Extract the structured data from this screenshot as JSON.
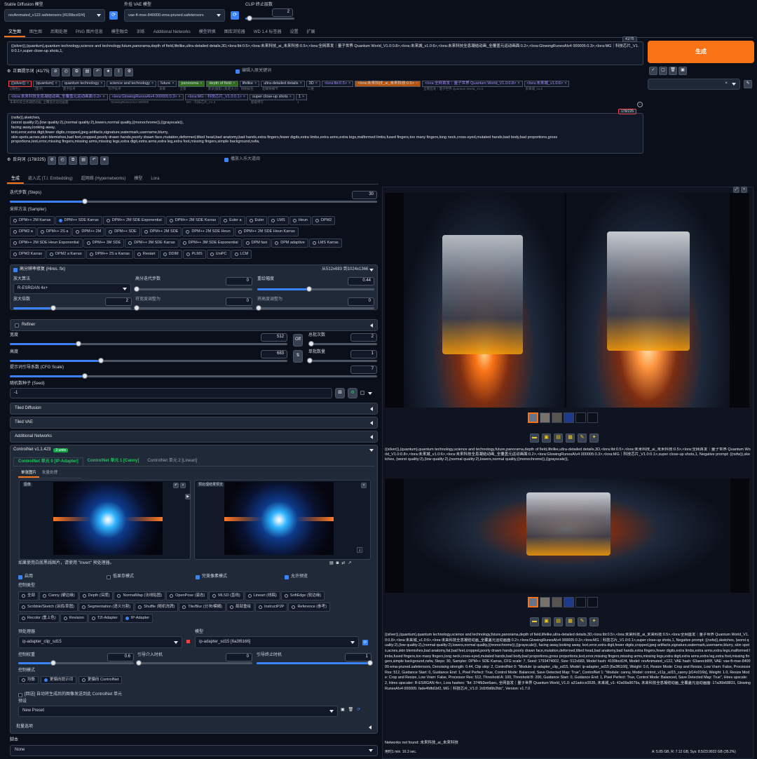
{
  "top": {
    "sd_model_label": "Stable Diffusion 模型",
    "sd_model_value": "revAnimated_v122.safetensors [4199bcd1f4]",
    "vae_label": "外挂 VAE 模型",
    "vae_value": "vae-ft-mse-840000-ema-pruned.safetensors",
    "clip_label": "CLIP 终止层数",
    "clip_value": "2"
  },
  "tabs": [
    "文生图",
    "图生图",
    "后期处理",
    "PNG 图片信息",
    "模型融合",
    "训练",
    "Additional Networks",
    "模型转换",
    "图库浏览器",
    "WD 1.4 标签器",
    "设置",
    "扩展"
  ],
  "prompt": {
    "text": "((silver)),(quantum),quantum technology,science and technology,future,panorama,depth of field,lifelike,ultra-detailed details,3D,<lora:lbt:0.5>,<lora:未来科技_ai_未来科技:0.5>,<lora:全网首发｜量子世界 Quantum World_V1.0:0.8>,<lora:未来城_v1.0:6>,<lora:未来科技全息凝结动画_全覆盖元运动画面:0.2>,<lora:GlowingRunesAIv4 000005:0.3>,<lora:MG｜科技芯片_V1.0:0.1>,super close-up shots,1,",
    "count": "41/75"
  },
  "generate_label": "生成",
  "pos_toolbar": {
    "label": "正面提示词",
    "count": "(41/75)",
    "translate_label": "编辑入原关键词"
  },
  "tokens_row1": [
    {
      "t": "((silver))",
      "s": "((银色))",
      "style": "red"
    },
    {
      "t": "(quantum)",
      "s": "(量子)"
    },
    {
      "t": "quantum technology",
      "s": "量子技术"
    },
    {
      "t": "science and technology",
      "s": "科学技术"
    },
    {
      "t": "future",
      "s": "未来"
    },
    {
      "t": "panorama",
      "s": "全景",
      "style": "green"
    },
    {
      "t": "depth of field",
      "s": "景深(摄影) (焦距大小)",
      "style": "green"
    },
    {
      "t": "lifelike",
      "s": "栩栩如生"
    },
    {
      "t": "ultra-detailed details",
      "s": "超细致细节"
    },
    {
      "t": "3D",
      "s": "三维"
    },
    {
      "t": "<lora:lbt:0.5>",
      "s": "",
      "style": "purple"
    },
    {
      "t": "<lora:未来科技_ai_未来科技:0.5>",
      "s": "",
      "style": "orange"
    },
    {
      "t": "<lora:全网首发｜量子世界 Quantum World_V1.0:0.8>",
      "s": "全网首发｜量子世界 Quantum World_V1.0",
      "style": "purple"
    },
    {
      "t": "<lora:未来城_v1.0:6>",
      "s": "未来城_v1.0",
      "style": "purple"
    }
  ],
  "tokens_row2": [
    {
      "t": "<lora:未来科技全息凝结动画_全覆盖元运动画面:0.2>",
      "s": "未来科技全息凝结动画_全覆盖元运动画面",
      "style": "purple"
    },
    {
      "t": "<lora:GlowingRunesAIv4 000005:0.3>",
      "s": "GlowingRunesAIv4 000005",
      "style": "purple"
    },
    {
      "t": "<lora:MG｜科技芯片_V1.0:0.1>",
      "s": "MG｜科技芯片_V1.0",
      "style": "purple"
    },
    {
      "t": "super close-up shots",
      "s": "超级特写"
    },
    {
      "t": "1",
      "s": "1"
    }
  ],
  "negative": {
    "lines": [
      "(nsfw)),sketches,",
      "(worst quality:2),(low quality:2),(normal quality:2),lowers,normal quality,((monochrome)),((grayscale)),",
      "facing away,looking away,",
      "text,error,extra digit,fewer digits,cropped,jpeg artifacts,signature,watermark,username,blurry,",
      "skin spots,acnes,skin blemishes,bad feet,cropped,poorly drawn hands,poorly drawn face,mutation,deformed,tilted head,bad anatomy,bad hands,extra fingers,fewer digits,extra limbs,extra arms,extra legs,malformed limbs,fused fingers,too many fingers,long neck,cross-eyed,mutated hands,bad body,bad proportions,gross",
      "proportions,text,error,missing fingers,missing arms,missing legs,extra digit,extra arms,extra leg,extra foot,missing fingers,simple background,nsfw,"
    ],
    "count": "178/225"
  },
  "neg_toolbar": {
    "label": "反向词",
    "count": "(178/225)",
    "translate_label": "播放入乐大道阅"
  },
  "subtabs": [
    "生成",
    "嵌入式 (T.I. Embedding)",
    "超网络 (Hypernetworks)",
    "模型",
    "Lora"
  ],
  "steps": {
    "label": "迭代步数 (Steps)",
    "value": "30",
    "frac": 0.2
  },
  "sampler": {
    "label": "采样方法 (Sampler)",
    "rows": [
      [
        "DPM++ 2M Karras",
        "DPM++ SDE Karras",
        "DPM++ 2M SDE Exponential",
        "DPM++ 2M SDE Karras",
        "Euler a",
        "Euler",
        "LMS",
        "Heun",
        "DPM2"
      ],
      [
        "DPM2 a",
        "DPM++ 2S a",
        "DPM++ 2M",
        "DPM++ SDE",
        "DPM++ 2M SDE",
        "DPM++ 2M SDE Heun",
        "DPM++ 2M SDE Heun Karras"
      ],
      [
        "DPM++ 2M SDE Heun Exponential",
        "DPM++ 3M SDE",
        "DPM++ 3M SDE Karras",
        "DPM++ 3M SDE Exponential",
        "DPM fast",
        "DPM adaptive",
        "LMS Karras"
      ],
      [
        "DPM2 Karras",
        "DPM2 a Karras",
        "DPM++ 2S a Karras",
        "Restart",
        "DDIM",
        "PLMS",
        "UniPC",
        "LCM"
      ]
    ],
    "selected": "DPM++ SDE Karras"
  },
  "hires": {
    "label": "高分辨率修复 (Hires. fix)",
    "info": "从512x683 到1024x1366",
    "upscaler_label": "放大算法",
    "upscaler_value": "R-ESRGAN 4x+",
    "steps_label": "高分迭代步数",
    "steps_value": "0",
    "denoise_label": "重绘幅度",
    "denoise_value": "0.44",
    "scale_label": "放大倍数",
    "scale_value": "2",
    "w_label": "将宽度调整为",
    "w_value": "0",
    "h_label": "将高度调整为",
    "h_value": "0"
  },
  "refiner_label": "Refiner",
  "size": {
    "width_label": "宽度",
    "width_value": "512",
    "height_label": "高度",
    "height_value": "683",
    "batch_count_label": "总批次数",
    "batch_count_value": "2",
    "batch_size_label": "单批数量",
    "batch_size_value": "1",
    "cfg_label": "提示词引导系数 (CFG Scale)",
    "cfg_value": "7",
    "off": "Off"
  },
  "seed": {
    "label": "随机数种子 (Seed)",
    "value": "-1"
  },
  "sections": [
    "Tiled Diffusion",
    "Tiled VAE",
    "Additional Networks"
  ],
  "controlnet": {
    "title": "ControlNet v1.1.423",
    "badge": "3 units",
    "units": [
      "ControlNet 单元 0 [IP-Adapter]",
      "ControlNet 单元 1 [Canny]",
      "ControlNet 单元 2 [Lineart]"
    ],
    "img_tabs": [
      "单张图片",
      "批量处理"
    ],
    "img_label": "图像",
    "preview_label": "预处理结果预览",
    "hint": "如果使用白底黑线图片，请使用 \"Invert\" 预处理器。",
    "enable": "启用",
    "lowvram": "低显存模式",
    "pixel_perfect": "完美像素模式",
    "allow_preview": "允许预览",
    "control_type_label": "控制类型",
    "control_types": [
      "全部",
      "Canny (硬边缘)",
      "Depth (深度)",
      "NormalMap (法线贴图)",
      "OpenPose (姿态)",
      "MLSD (直线)",
      "Lineart (线稿)",
      "SoftEdge (软边缘)",
      "Scribble/Sketch (涂鸦/草图)",
      "Segmentation (语义分割)",
      "Shuffle (随机洗牌)",
      "Tile/Blur (分块/模糊)",
      "局部重绘",
      "InstructP2P",
      "Reference (参考)",
      "Recolor (重上色)",
      "Revision",
      "T2I-Adapter",
      "IP-Adapter"
    ],
    "selected_type": "IP-Adapter",
    "preprocessor_label": "预处理器",
    "preprocessor_value": "ip-adapter_clip_sd15",
    "model_label": "模型",
    "model_value": "ip-adapter_sd15 [6a3f6166]",
    "weight_label": "控制权重",
    "weight_value": "0.6",
    "start_label": "引导介入时机",
    "start_value": "0",
    "end_label": "引导终止时机",
    "end_value": "1",
    "mode_label": "控制模式",
    "modes": [
      "均衡",
      "更偏向提示词",
      "更偏向 ControlNet"
    ],
    "mode_selected": "更偏向提示词",
    "loopback": "[回送] 自动将生成后的图像发送到此 ControlNet 单元",
    "preset_label": "预设",
    "preset_value": "New Preset",
    "batch_opts": "批量选项"
  },
  "script": {
    "label": "脚本",
    "value": "None"
  },
  "out_text1": "((silver)),(quantum),quantum technology,science and technology,future,panorama,depth of field,lifelike,ultra-detailed details,3D,<lora:lbt:0.5>,<lora:未来科技_ai_未来科技:0.5>,<lora:全网首发｜量子世界 Quantum World_V1.0:0.8>,<lora:未来城_v1.0:6>,<lora:未来科技全息凝结动画_全覆盖元运动画面:0.2>,<lora:GlowingRunesAIv4 000005:0.3>,<lora:MG｜科技芯片_V1.0:0.1>,super close-up shots,1, Negative prompt: ((nsfw)),sketches, (worst quality:2),(low quality:2),(normal quality:2),lowers,normal quality,((monochrome)),((grayscale)),",
  "out_text2": "((silver)),(quantum),quantum technology,science and technology,future,panorama,depth of field,lifelike,ultra-detailed details,3D,<lora:lbt:0.5>,<lora:未来科技_ai_未来科技:0.5>,<lora:全网首发｜量子世界 Quantum World_V1.0:0.8>,<lora:未来城_v1.0:6>,<lora:未来科技全息凝结动画_全覆盖元运动画面:0.2>,<lora:GlowingRunesAIv4 000005:0.3>,<lora:MG｜科技芯片_V1.0:0.1>,super close-up shots,1, Negative prompt: ((nsfw)),sketches, (worst quality:2),(low quality:2),(normal quality:2),lowers,normal quality,((monochrome)),((grayscale)), facing away,looking away, text,error,extra digit,fewer digits,cropped,jpeg artifacts,signature,watermark,username,blurry, skin spots,acnes,skin blemishes,bad anatomy,fat,bad feet,cropped,poorly drawn hands,poorly drawn face,mutation,deformed,tilted head,bad anatomy,bad hands,extra fingers,fewer digits,extra limbs,extra arms,extra legs,malformed limbs,fused fingers,too many fingers,long neck,cross-eyed,mutated hands,bad body,bad proportions,gross proportions,text,error,missing fingers,missing arms,missing legs,extra digit,extra arms,extra leg,extra foot,missing fingers,simple background,nsfw, Steps: 30, Sampler: DPM++ SDE Karras, CFG scale: 7, Seed: 1793474002, Size: 512x683, Model hash: 4199bcd1f4, Model: revAnimated_v122, VAE hash: 63aeecb90f, VAE: vae-ft-mse-840000-ema-pruned.safetensors, Denoising strength: 0.44, Clip skip: 2, ControlNet 0: \"Module: ip-adapter_clip_sd15, Model: ip-adapter_sd15 [6a3f6166], Weight: 0.6, Resize Mode: Crop and Resize, Low Vram: False, Processor Res: 512, Guidance Start: 0, Guidance End: 1, Pixel Perfect: True, Control Mode: Balanced, Save Detected Map: True\", ControlNet 1: \"Module: canny, Model: control_v11p_sd15_canny [d14c016b], Weight: 1.0, Resize Mode: Crop and Resize, Low Vram: False, Processor Res: 512, Threshold A: 100, Threshold B: 200, Guidance Start: 0, Guidance End: 1, Pixel Perfect: True, Control Mode: Balanced, Save Detected Map: True\", Hires upscale: 2, Hires upscaler: R-ESRGAN 4x+, Lora hashes: \"lbt: 374fb3ee6aec, 全网首发｜量子世界 Quantum World_V1.0: a31adcce3535, 未来城_v1: 42a09a9079a, 未来科技全息凝结动画_全覆盖元运动画面: 17a36b68831, GlowingRunesAIv4 000005: fade4fdfd1bf2, MG｜科技芯片_V1.0: 2d1f0d6b2fdc\", Version: v1.7.0",
  "networks_not_found": "Networks not found: 未来科技_ai_未来科技",
  "time": "用时1 min. 16.3 sec.",
  "mem": "A: 5.85 GB, R: 7.12 GB, Sys: 8.5/23.9922 GB (35.2%)"
}
